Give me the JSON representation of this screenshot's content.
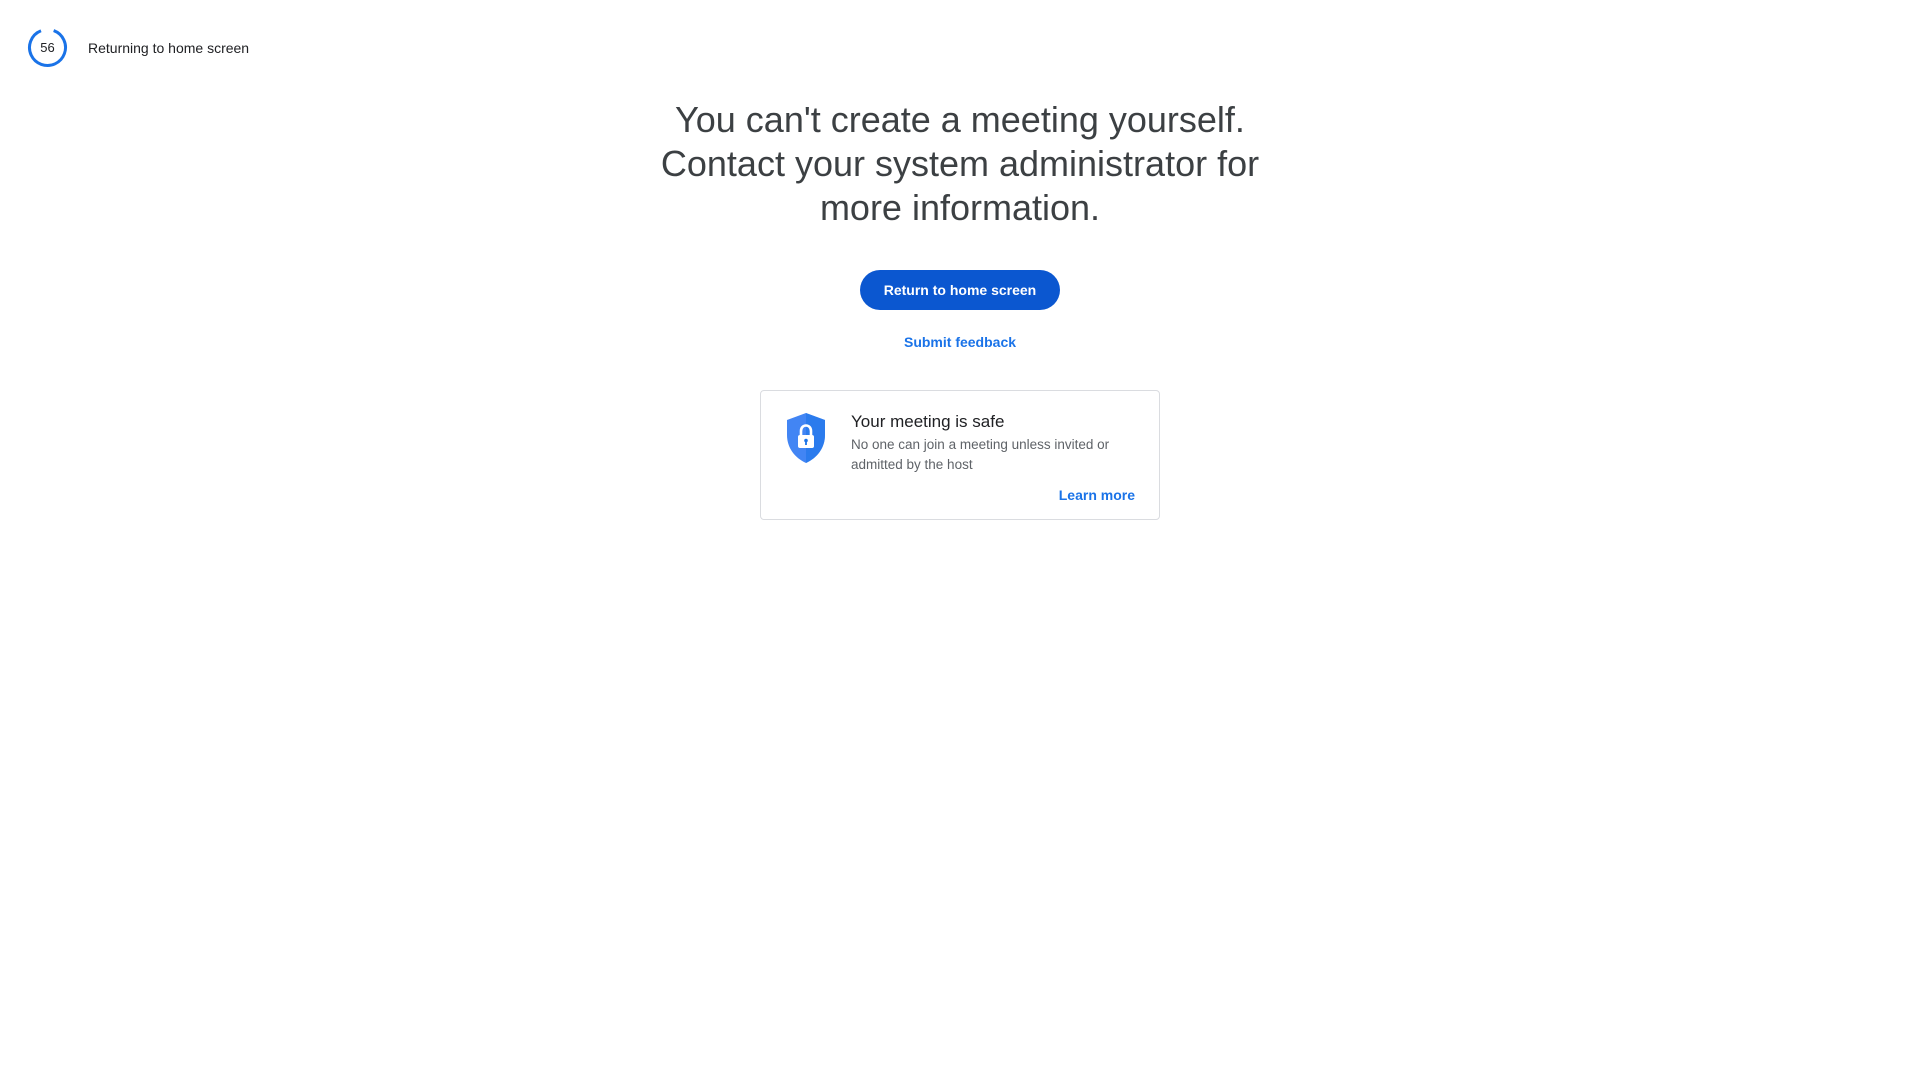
{
  "countdown": {
    "seconds": "56",
    "label": "Returning to home screen",
    "ring_color": "#1a73e8"
  },
  "main": {
    "headline": "You can't create a meeting yourself. Contact your system administrator for more information.",
    "return_button_label": "Return to home screen",
    "feedback_link_label": "Submit feedback"
  },
  "safety_card": {
    "icon": "shield-lock-icon",
    "title": "Your meeting is safe",
    "body": "No one can join a meeting unless invited or admitted by the host",
    "learn_more_label": "Learn more"
  },
  "colors": {
    "primary_button": "#0b57d0",
    "link": "#1a73e8",
    "shield": "#4285f4"
  }
}
